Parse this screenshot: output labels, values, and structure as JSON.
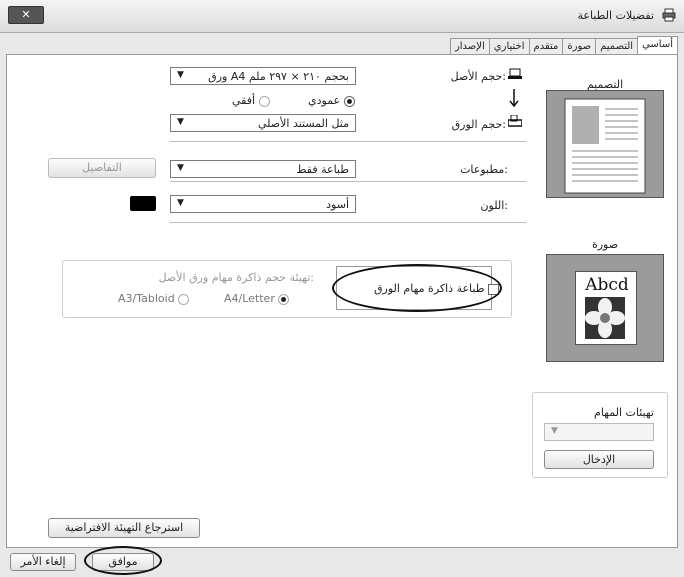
{
  "window": {
    "title": "تفضيلات الطباعة",
    "close_label": "✕"
  },
  "tabs": [
    "أساسي",
    "التصميم",
    "صورة",
    "متقدم",
    "اختياري",
    "الإصدار"
  ],
  "original_size": {
    "label": "حجم الأصل:",
    "value": "ورق A4 بحجم ٢١٠ × ٢٩٧ ملم",
    "orientation_portrait": "عمودي",
    "orientation_landscape": "أفقي"
  },
  "paper_size": {
    "label": "حجم الورق:",
    "value": "مثل المستند الأصلي"
  },
  "output": {
    "label": "مطبوعات:",
    "value": "طباعة فقط",
    "details_button": "التفاصيل"
  },
  "color": {
    "label": "اللون:",
    "value": "أسود"
  },
  "memory": {
    "checkbox_label": "طباعة ذاكرة مهام الورق",
    "group_label": "تهيئة حجم ذاكرة مهام ورق الأصل:",
    "option_a4": "A4/Letter",
    "option_a3": "A3/Tabloid"
  },
  "layout_preview": {
    "label": "التصميم"
  },
  "image_preview": {
    "label": "صورة",
    "sample_text": "Abcd"
  },
  "job_settings": {
    "label": "تهيئات المهام",
    "enter_button": "الإدخال"
  },
  "restore_defaults_button": "استرجاع التهيئة الافتراضية",
  "ok_button": "موافق",
  "cancel_button": "إلغاء الأمر"
}
